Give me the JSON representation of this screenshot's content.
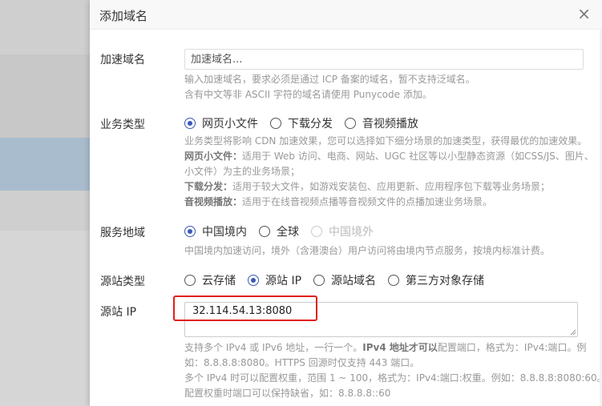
{
  "dialog": {
    "title": "添加域名",
    "close_label": "×"
  },
  "domain": {
    "label": "加速域名",
    "placeholder": "加速域名...",
    "help": [
      "输入加速域名，要求必须是通过 ICP 备案的域名，暂不支持泛域名。",
      "含有中文等非 ASCII 字符的域名请使用 Punycode 添加。"
    ]
  },
  "business_type": {
    "label": "业务类型",
    "options": [
      {
        "label": "网页小文件",
        "checked": true
      },
      {
        "label": "下载分发",
        "checked": false
      },
      {
        "label": "音视频播放",
        "checked": false
      }
    ],
    "help_line1": "业务类型将影响 CDN 加速效果，您可以选择如下细分场景的加速类型，获得最优的加速效果。",
    "help_web_title": "网页小文件：",
    "help_web_text": "适用于 Web 访问、电商、网站、UGC 社区等以小型静态资源（如CSS/JS、图片、",
    "help_web_text2": "小文件）为主的业务场景；",
    "help_download_title": "下载分发：",
    "help_download_text": "适用于较大文件，如游戏安装包、应用更新、应用程序包下载等业务场景；",
    "help_media_title": "音视频播放：",
    "help_media_text": "适用于在线音视频点播等音视频文件的点播加速业务场景。"
  },
  "service_region": {
    "label": "服务地域",
    "options": [
      {
        "label": "中国境内",
        "checked": true
      },
      {
        "label": "全球",
        "checked": false
      },
      {
        "label": "中国境外",
        "checked": false,
        "disabled": true
      }
    ],
    "help": "中国境内加速访问，境外（含港澳台）用户访问将由境内节点服务，按境内标准计费。"
  },
  "origin_type": {
    "label": "源站类型",
    "options": [
      {
        "label": "云存储",
        "checked": false
      },
      {
        "label": "源站 IP",
        "checked": true
      },
      {
        "label": "源站域名",
        "checked": false
      },
      {
        "label": "第三方对象存储",
        "checked": false
      }
    ]
  },
  "origin_ip": {
    "label": "源站 IP",
    "value": "32.114.54.13:8080",
    "help1_pre": "支持多个 IPv4 或 IPv6 地址，一行一个。",
    "help1_bold": "IPv4 地址才可以",
    "help1_post": "配置端口，格式为：IPv4:端口。例",
    "help2": "如：8.8.8.8:8080。HTTPS 回源时仅支持 443 端口。",
    "help3": "多个 IPv4 时可以配置权重，范围 1 ~ 100，格式为：IPv4:端口:权重。例如：8.8.8.8:8080:60。",
    "help4": "配置权重时端口可以保持缺省，如：8.8.8.8::60"
  },
  "colors": {
    "accent": "#3a58b8",
    "highlight": "#e0201b"
  }
}
